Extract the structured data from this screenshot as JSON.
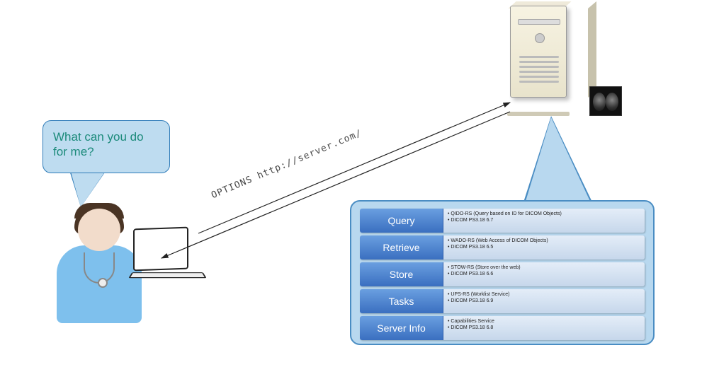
{
  "question_bubble": {
    "text": "What can you do for me?"
  },
  "request_label": "OPTIONS http://server.com/",
  "capabilities": [
    {
      "label": "Query",
      "line1": "QIDO-RS (Query based on ID for DICOM Objects)",
      "line2": "DICOM PS3.18 6.7"
    },
    {
      "label": "Retrieve",
      "line1": "WADO-RS (Web Access of DICOM Objects)",
      "line2": "DICOM PS3.18 6.5"
    },
    {
      "label": "Store",
      "line1": "STOW-RS (Store over the web)",
      "line2": "DICOM PS3.18 6.6"
    },
    {
      "label": "Tasks",
      "line1": "UPS-RS (Worklist Service)",
      "line2": "DICOM PS3.18 6.9"
    },
    {
      "label": "Server Info",
      "line1": "Capabilities Service",
      "line2": "DICOM PS3.18 6.8"
    }
  ]
}
